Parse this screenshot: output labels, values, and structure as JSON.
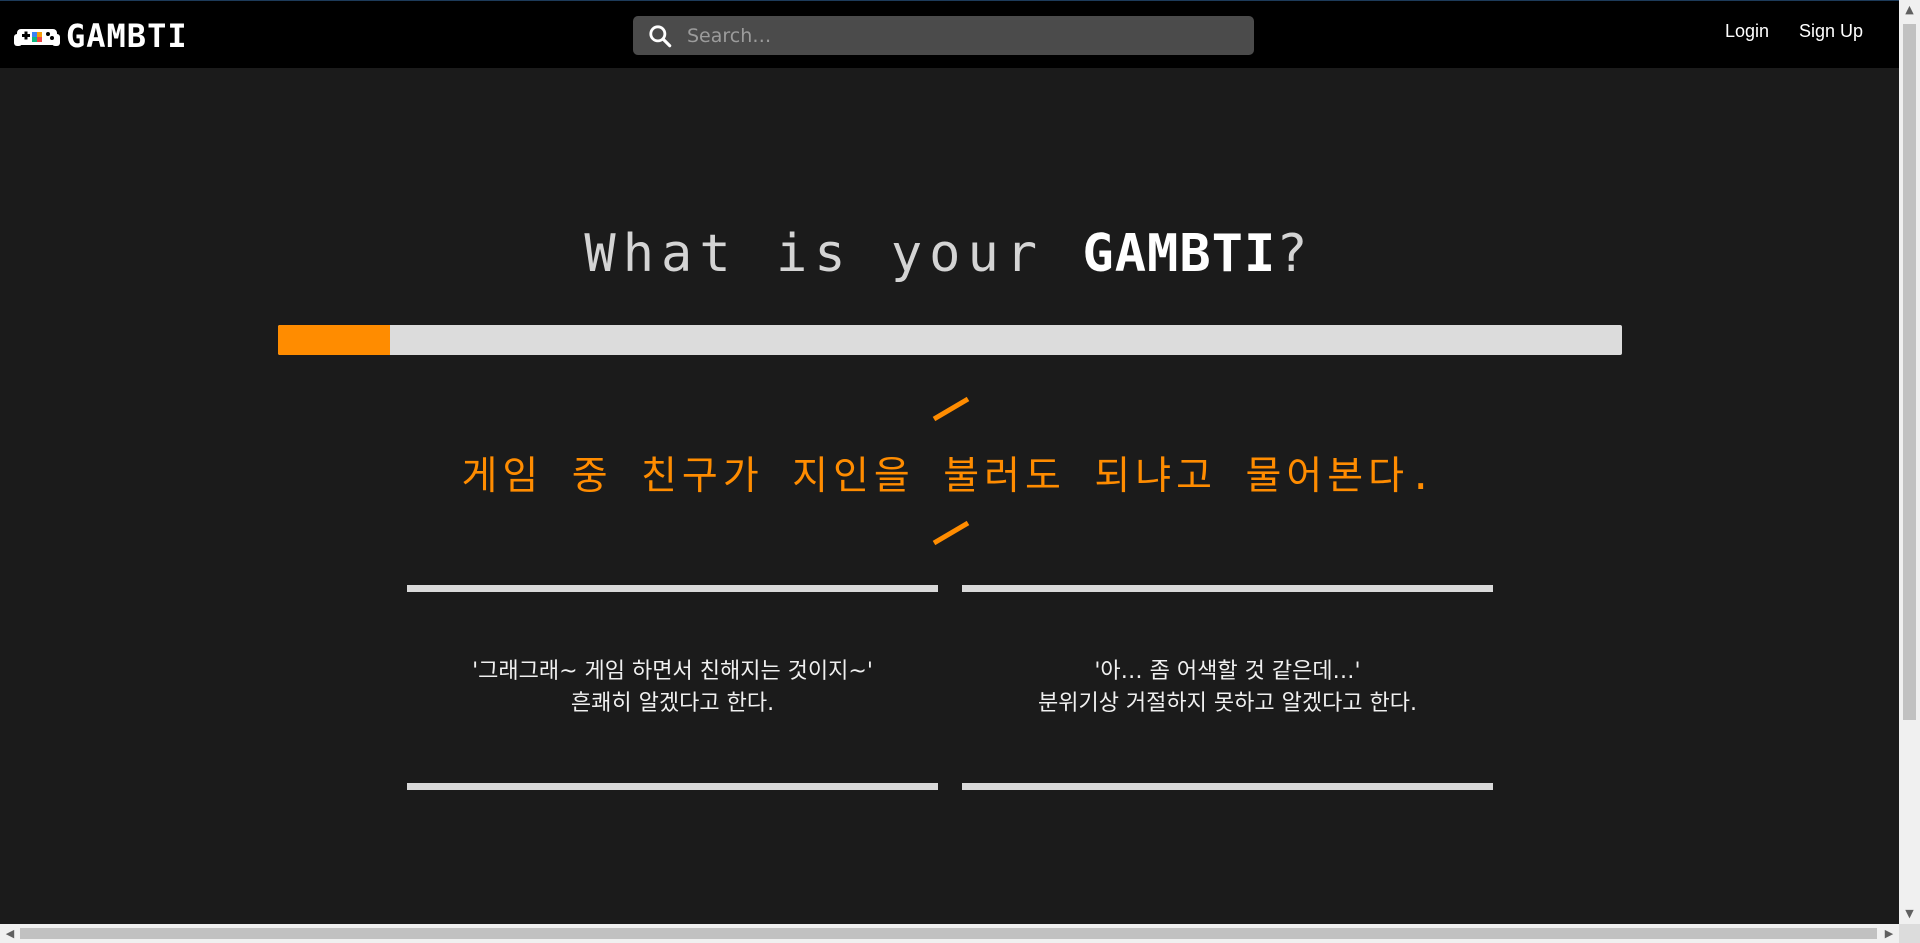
{
  "header": {
    "logo_text": "GAMBTI",
    "search": {
      "placeholder": "Search…",
      "value": ""
    },
    "nav": {
      "login": "Login",
      "signup": "Sign Up"
    }
  },
  "main": {
    "title_prefix": "What is your ",
    "title_brand": "GAMBTI",
    "title_suffix": "?",
    "progress_fraction": 0.083,
    "question": "게임 중 친구가 지인을 불러도 되냐고 물어본다.",
    "answers": [
      {
        "line1": "'그래그래~ 게임 하면서 친해지는 것이지~'",
        "line2": "흔쾌히 알겠다고 한다."
      },
      {
        "line1": "'아… 좀 어색할 것 같은데…'",
        "line2": "분위기상 거절하지 못하고 알겠다고 한다."
      }
    ]
  },
  "colors": {
    "accent": "#ff8c00",
    "background": "#1b1b1b",
    "header_bg": "#000000",
    "search_bg": "#4b4b4b",
    "progress_track": "#dcdcdc"
  },
  "icons": {
    "logo": "gamepad-icon",
    "search": "search-icon"
  }
}
